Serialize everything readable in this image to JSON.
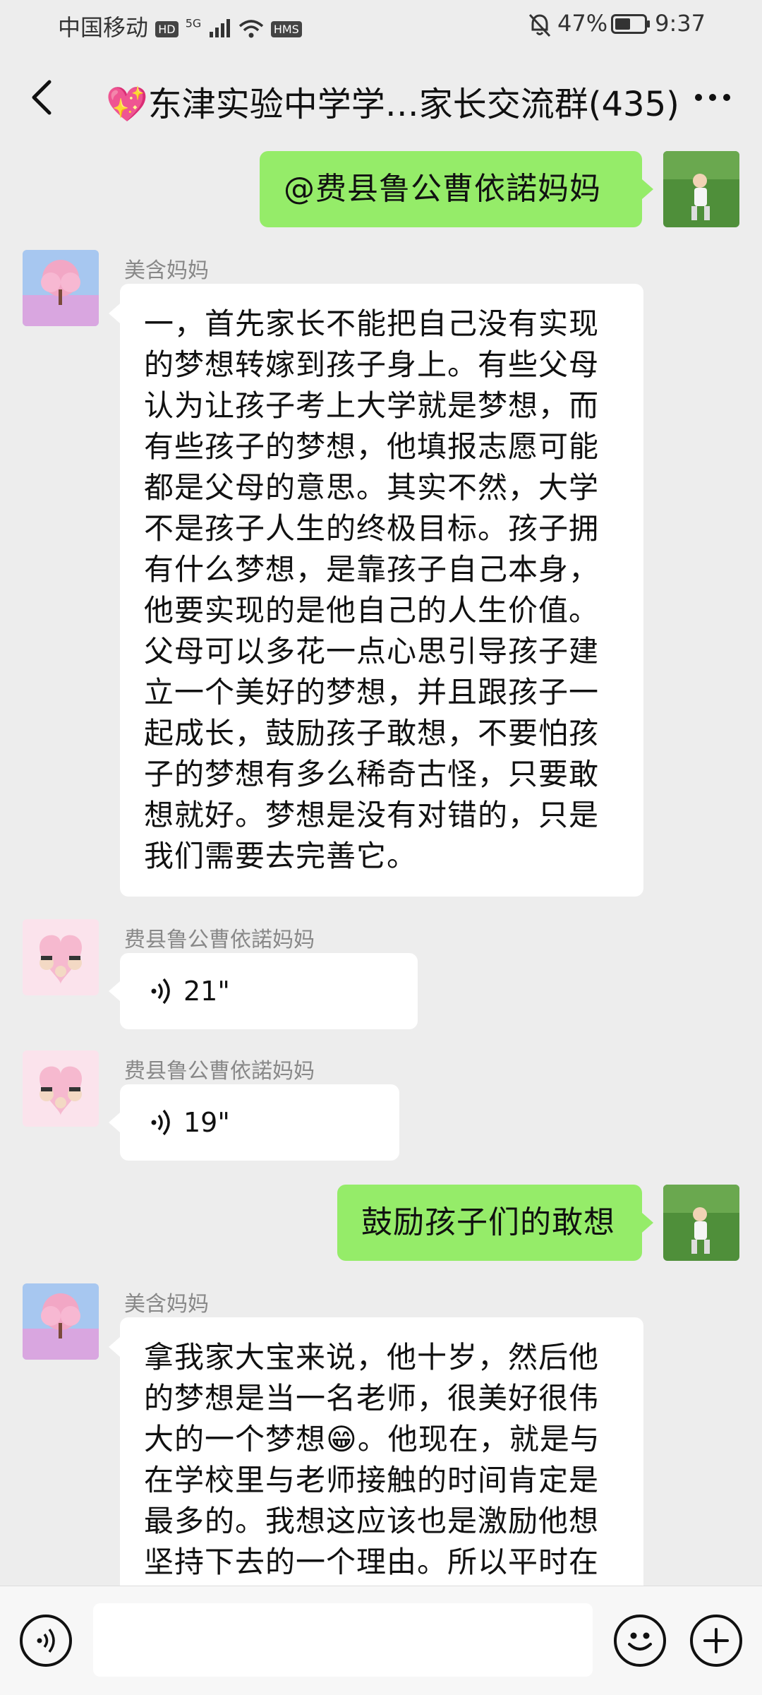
{
  "status_bar": {
    "carrier": "中国移动",
    "hd": "HD",
    "network": "5G",
    "hms": "HMS",
    "battery": "47%",
    "time": "9:37"
  },
  "header": {
    "title": "💖东津实验中学学…家长交流群(435)"
  },
  "messages": [
    {
      "type": "out",
      "text": "@费县鲁公曹依諾妈妈"
    },
    {
      "type": "in",
      "sender": "美含妈妈",
      "text": "一，首先家长不能把自己没有实现的梦想转嫁到孩子身上。有些父母认为让孩子考上大学就是梦想，而有些孩子的梦想，他填报志愿可能都是父母的意思。其实不然，大学不是孩子人生的终极目标。孩子拥有什么梦想，是靠孩子自己本身，他要实现的是他自己的人生价值。父母可以多花一点心思引导孩子建立一个美好的梦想，并且跟孩子一起成长，鼓励孩子敢想，不要怕孩子的梦想有多么稀奇古怪，只要敢想就好。梦想是没有对错的，只是我们需要去完善它。"
    },
    {
      "type": "voice",
      "sender": "费县鲁公曹依諾妈妈",
      "duration": "21\""
    },
    {
      "type": "voice",
      "sender": "费县鲁公曹依諾妈妈",
      "duration": "19\""
    },
    {
      "type": "out",
      "text": "鼓励孩子们的敢想"
    },
    {
      "type": "in",
      "sender": "美含妈妈",
      "text": "拿我家大宝来说，他十岁，然后他的梦想是当一名老师，很美好很伟大的一个梦想😁。他现在，就是与在学校里与老师接触的时间肯定是最多的。我想这应该也是激励他想坚持下去的一个理由。所以平时在"
    }
  ],
  "input_bar": {
    "message_value": ""
  },
  "colors": {
    "background": "#ededed",
    "outgoing_bubble": "#95ec69",
    "incoming_bubble": "#ffffff"
  }
}
